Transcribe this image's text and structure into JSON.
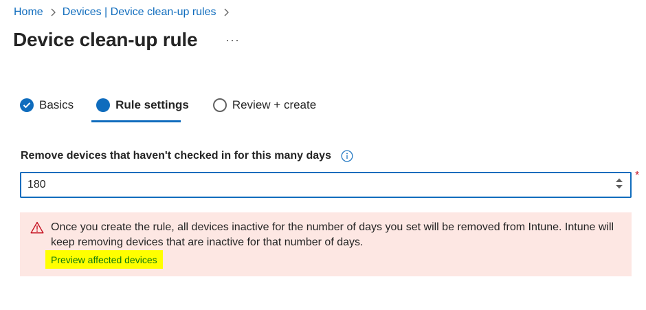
{
  "breadcrumb": {
    "items": [
      {
        "label": "Home"
      },
      {
        "label": "Devices | Device clean-up rules"
      }
    ]
  },
  "page": {
    "title": "Device clean-up rule",
    "more_label": "···"
  },
  "wizard": {
    "tabs": [
      {
        "label": "Basics",
        "state": "complete"
      },
      {
        "label": "Rule settings",
        "state": "current"
      },
      {
        "label": "Review + create",
        "state": "pending"
      }
    ]
  },
  "form": {
    "days_label": "Remove devices that haven't checked in for this many days",
    "days_value": "180",
    "required_mark": "*"
  },
  "warning": {
    "message": "Once you create the rule, all devices inactive for the number of days you set will be removed from Intune. Intune will keep removing devices that are inactive for that number of days.",
    "link_label": "Preview affected devices"
  },
  "colors": {
    "accent": "#0f6cbd",
    "warning_bg": "#fde7e3",
    "warning_icon": "#c50f1f",
    "highlight": "#ffff00",
    "link_green": "#0e7a0d"
  }
}
